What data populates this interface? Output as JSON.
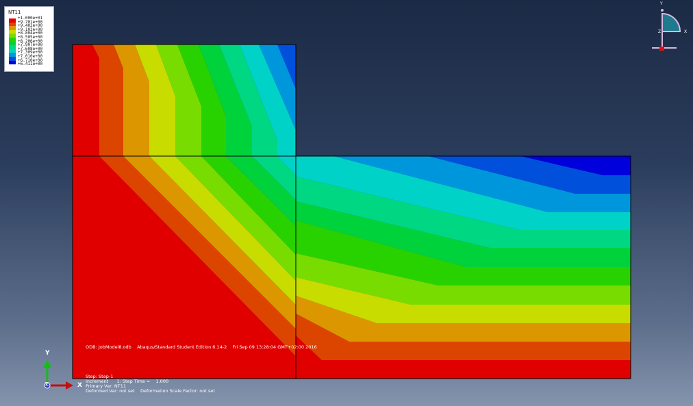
{
  "legend": {
    "title": "NT11",
    "entries": [
      {
        "label": "+1.000e+01",
        "color": "#e60000"
      },
      {
        "label": "+9.701e+00",
        "color": "#dc4500"
      },
      {
        "label": "+9.402e+00",
        "color": "#dc9600"
      },
      {
        "label": "+9.103e+00",
        "color": "#c8dc00"
      },
      {
        "label": "+8.804e+00",
        "color": "#78dc00"
      },
      {
        "label": "+8.505e+00",
        "color": "#28d200"
      },
      {
        "label": "+8.206e+00",
        "color": "#00d23c"
      },
      {
        "label": "+7.907e+00",
        "color": "#00d782"
      },
      {
        "label": "+7.608e+00",
        "color": "#00d2c8"
      },
      {
        "label": "+7.309e+00",
        "color": "#0096dc"
      },
      {
        "label": "+7.010e+00",
        "color": "#0050dc"
      },
      {
        "label": "+6.710e+00",
        "color": "#0000dc"
      },
      {
        "label": "+6.411e+00",
        "color": ""
      }
    ]
  },
  "info": {
    "odb_line": "ODB: JobModel8.odb    Abaqus/Standard Student Edition 6.14-2    Fri Sep 09 13:28:04 GMT+02:00 2016",
    "step_line": "Step: Step-1",
    "increment_line": "Increment      1: Step Time =    1.000",
    "primary_var_line": "Primary Var: NT11",
    "deformed_var_line": "Deformed Var: not set    Deformation Scale Factor: not set"
  },
  "triad": {
    "y": "Y",
    "x": "X",
    "z": "Z"
  },
  "view_cube": {
    "y": "Y",
    "x": "X",
    "z": "Z"
  },
  "colors": {
    "red": "#e10000",
    "orange_red": "#dc4500",
    "orange": "#dc9600",
    "yellow": "#c8dc00",
    "yellow_green": "#78dc00",
    "green": "#28d200",
    "green2": "#00d23c",
    "teal_green": "#00d782",
    "cyan": "#00d2c8",
    "light_blue": "#0096dc",
    "blue": "#0050dc",
    "deep_blue": "#0000dc"
  }
}
